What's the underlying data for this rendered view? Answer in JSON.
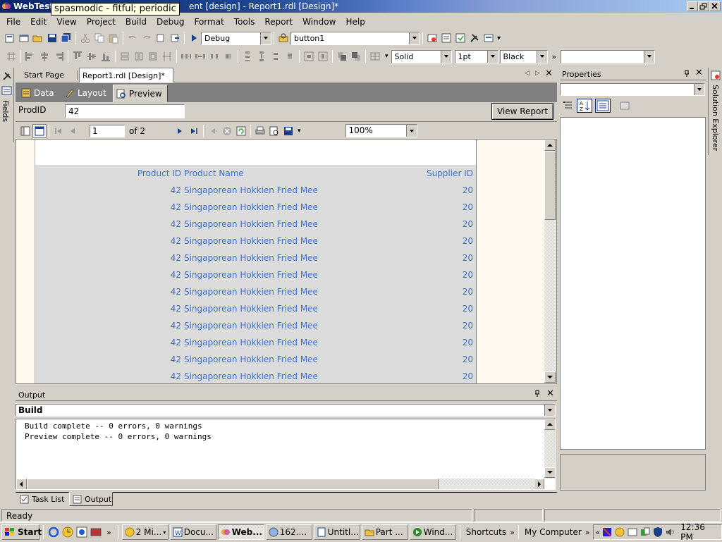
{
  "titlebar": {
    "app": "WebTest",
    "tooltip": "spasmodic - fitful; periodic",
    "title": "ent [design] - Report1.rdl [Design]*"
  },
  "menu": [
    "File",
    "Edit",
    "View",
    "Project",
    "Build",
    "Debug",
    "Format",
    "Tools",
    "Report",
    "Window",
    "Help"
  ],
  "toolbar": {
    "config": "Debug",
    "find": "button1",
    "border_style": "Solid",
    "border_width": "1pt",
    "border_color": "Black",
    "font": ""
  },
  "tabs": {
    "start": "Start Page",
    "report": "Report1.rdl [Design]*"
  },
  "designer_tabs": {
    "data": "Data",
    "layout": "Layout",
    "preview": "Preview"
  },
  "params": {
    "label": "ProdID",
    "value": "42",
    "view_button": "View Report"
  },
  "report_toolbar": {
    "page": "1",
    "of": "of 2",
    "zoom": "100%"
  },
  "report": {
    "headers": {
      "id": "Product ID",
      "name": "Product Name",
      "supplier": "Supplier ID"
    },
    "rows": [
      {
        "id": "42",
        "name": "Singaporean Hokkien Fried Mee",
        "supplier": "20"
      },
      {
        "id": "42",
        "name": "Singaporean Hokkien Fried Mee",
        "supplier": "20"
      },
      {
        "id": "42",
        "name": "Singaporean Hokkien Fried Mee",
        "supplier": "20"
      },
      {
        "id": "42",
        "name": "Singaporean Hokkien Fried Mee",
        "supplier": "20"
      },
      {
        "id": "42",
        "name": "Singaporean Hokkien Fried Mee",
        "supplier": "20"
      },
      {
        "id": "42",
        "name": "Singaporean Hokkien Fried Mee",
        "supplier": "20"
      },
      {
        "id": "42",
        "name": "Singaporean Hokkien Fried Mee",
        "supplier": "20"
      },
      {
        "id": "42",
        "name": "Singaporean Hokkien Fried Mee",
        "supplier": "20"
      },
      {
        "id": "42",
        "name": "Singaporean Hokkien Fried Mee",
        "supplier": "20"
      },
      {
        "id": "42",
        "name": "Singaporean Hokkien Fried Mee",
        "supplier": "20"
      },
      {
        "id": "42",
        "name": "Singaporean Hokkien Fried Mee",
        "supplier": "20"
      },
      {
        "id": "42",
        "name": "Singaporean Hokkien Fried Mee",
        "supplier": "20"
      }
    ]
  },
  "side": {
    "fields": "Fields",
    "solution_explorer": "Solution Explorer"
  },
  "properties": {
    "title": "Properties"
  },
  "output": {
    "title": "Output",
    "selector": "Build",
    "lines": [
      "Build complete -- 0 errors, 0 warnings",
      "Preview complete -- 0 errors, 0 warnings"
    ]
  },
  "bottom_tabs": {
    "task_list": "Task List",
    "output": "Output"
  },
  "status": {
    "text": "Ready"
  },
  "taskbar": {
    "start": "Start",
    "items": [
      "2 Mi...",
      "Docu...",
      "Web...",
      "162....",
      "Untitl...",
      "Part ...",
      "Wind..."
    ],
    "shortcuts": "Shortcuts",
    "my_computer": "My Computer",
    "clock": "12:36 PM"
  },
  "colors": {
    "report_text": "#3c6ed1",
    "titlebar": "#0a246a",
    "body_bg": "#dcdcdc"
  }
}
